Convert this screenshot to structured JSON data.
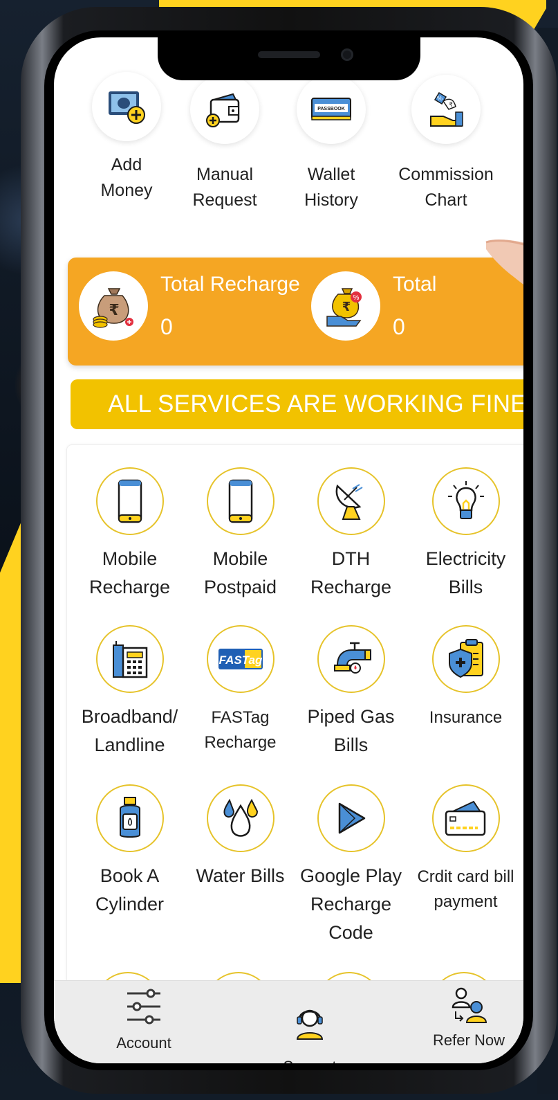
{
  "quick_actions": [
    {
      "label": "Add\nMoney",
      "icon": "add-money-icon"
    },
    {
      "label": "Manual\nRequest",
      "icon": "wallet-icon"
    },
    {
      "label": "Wallet\nHistory",
      "icon": "passbook-icon",
      "icon_text": "PASSBOOK"
    },
    {
      "label": "Commission\nChart",
      "icon": "commission-icon"
    }
  ],
  "stats": [
    {
      "label": "Total Recharge",
      "value": "0",
      "icon": "money-bag-icon"
    },
    {
      "label": "Total",
      "value": "0",
      "icon": "commission-bag-icon"
    }
  ],
  "status_banner": "ALL SERVICES ARE WORKING FINE.!",
  "services": [
    {
      "label": "Mobile\nRecharge",
      "icon": "mobile-icon"
    },
    {
      "label": "Mobile\nPostpaid",
      "icon": "mobile-postpaid-icon"
    },
    {
      "label": "DTH\nRecharge",
      "icon": "satellite-dish-icon"
    },
    {
      "label": "Electricity\nBills",
      "icon": "light-bulb-icon"
    },
    {
      "label": "Broadband/\nLandline",
      "icon": "landline-phone-icon"
    },
    {
      "label": "FASTag\nRecharge",
      "icon": "fastag-icon",
      "icon_text": "FASTag"
    },
    {
      "label": "Piped Gas\nBills",
      "icon": "gas-pipe-icon"
    },
    {
      "label": "Insurance",
      "icon": "insurance-shield-icon"
    },
    {
      "label": "Book A\nCylinder",
      "icon": "gas-cylinder-icon"
    },
    {
      "label": "Water Bills",
      "icon": "water-drops-icon"
    },
    {
      "label": "Google Play\nRecharge\nCode",
      "icon": "google-play-icon"
    },
    {
      "label": "Crdit card bill\npayment",
      "icon": "credit-card-icon"
    }
  ],
  "bottom_nav": [
    {
      "label": "Account",
      "icon": "sliders-icon"
    },
    {
      "label": "Support",
      "icon": "headset-icon"
    },
    {
      "label": "Refer Now",
      "icon": "refer-users-icon"
    }
  ],
  "colors": {
    "accent_orange": "#f5a623",
    "banner_yellow": "#f2c200",
    "circle_border": "#e6c32a",
    "background_yellow": "#ffd21f"
  }
}
